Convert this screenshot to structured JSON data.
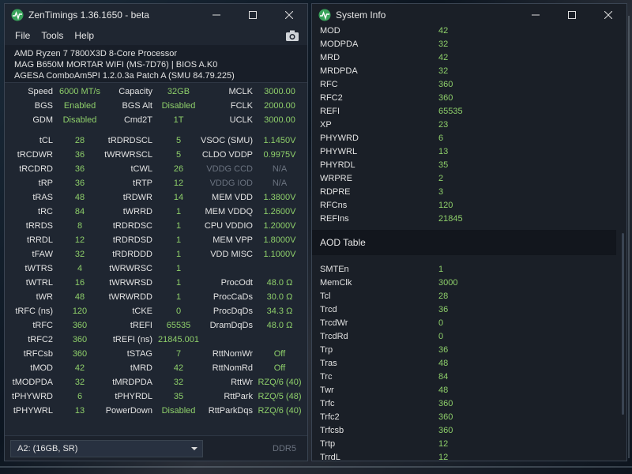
{
  "zentimings": {
    "title": "ZenTimings 1.36.1650 - beta",
    "menu": [
      "File",
      "Tools",
      "Help"
    ],
    "system": {
      "cpu": "AMD Ryzen 7 7800X3D 8-Core Processor",
      "board": "MAG B650M MORTAR WIFI (MS-7D76) | BIOS A.K0",
      "agesa": "AGESA ComboAm5PI 1.2.0.3a Patch A (SMU 84.79.225)"
    },
    "top_rows": [
      [
        "Speed",
        "6000 MT/s",
        "Capacity",
        "32GB",
        "MCLK",
        "3000.00"
      ],
      [
        "BGS",
        "Enabled",
        "BGS Alt",
        "Disabled",
        "FCLK",
        "2000.00"
      ],
      [
        "GDM",
        "Disabled",
        "Cmd2T",
        "1T",
        "UCLK",
        "3000.00"
      ]
    ],
    "rows": [
      [
        "tCL",
        "28",
        "tRDRDSCL",
        "5",
        "VSOC (SMU)",
        "1.1450V"
      ],
      [
        "tRCDWR",
        "36",
        "tWRWRSCL",
        "5",
        "CLDO VDDP",
        "0.9975V"
      ],
      [
        "tRCDRD",
        "36",
        "tCWL",
        "26",
        "VDDG CCD",
        "N/A"
      ],
      [
        "tRP",
        "36",
        "tRTP",
        "12",
        "VDDG IOD",
        "N/A"
      ],
      [
        "tRAS",
        "48",
        "tRDWR",
        "14",
        "MEM VDD",
        "1.3800V"
      ],
      [
        "tRC",
        "84",
        "tWRRD",
        "1",
        "MEM VDDQ",
        "1.2600V"
      ],
      [
        "tRRDS",
        "8",
        "tRDRDSC",
        "1",
        "CPU VDDIO",
        "1.2000V"
      ],
      [
        "tRRDL",
        "12",
        "tRDRDSD",
        "1",
        "MEM VPP",
        "1.8000V"
      ],
      [
        "tFAW",
        "32",
        "tRDRDDD",
        "1",
        "VDD MISC",
        "1.1000V"
      ],
      [
        "tWTRS",
        "4",
        "tWRWRSC",
        "1",
        "",
        ""
      ],
      [
        "tWTRL",
        "16",
        "tWRWRSD",
        "1",
        "ProcOdt",
        "48.0 Ω"
      ],
      [
        "tWR",
        "48",
        "tWRWRDD",
        "1",
        "ProcCaDs",
        "30.0 Ω"
      ],
      [
        "tRFC (ns)",
        "120",
        "tCKE",
        "0",
        "ProcDqDs",
        "34.3 Ω"
      ],
      [
        "tRFC",
        "360",
        "tREFI",
        "65535",
        "DramDqDs",
        "48.0 Ω"
      ],
      [
        "tRFC2",
        "360",
        "tREFI (ns)",
        "21845.001",
        "",
        ""
      ],
      [
        "tRFCsb",
        "360",
        "tSTAG",
        "7",
        "RttNomWr",
        "Off"
      ],
      [
        "tMOD",
        "42",
        "tMRD",
        "42",
        "RttNomRd",
        "Off"
      ],
      [
        "tMODPDA",
        "32",
        "tMRDPDA",
        "32",
        "RttWr",
        "RZQ/6 (40)"
      ],
      [
        "tPHYWRD",
        "6",
        "tPHYRDL",
        "35",
        "RttPark",
        "RZQ/5 (48)"
      ],
      [
        "tPHYWRL",
        "13",
        "PowerDown",
        "Disabled",
        "RttParkDqs",
        "RZQ/6 (40)"
      ]
    ],
    "dropdown_value": "A2: (16GB, SR)",
    "ddr_type": "DDR5"
  },
  "sysinfo": {
    "title": "System Info",
    "rows_top": [
      [
        "MOD",
        "42"
      ],
      [
        "MODPDA",
        "32"
      ],
      [
        "MRD",
        "42"
      ],
      [
        "MRDPDA",
        "32"
      ],
      [
        "RFC",
        "360"
      ],
      [
        "RFC2",
        "360"
      ],
      [
        "REFI",
        "65535"
      ],
      [
        "XP",
        "23"
      ],
      [
        "PHYWRD",
        "6"
      ],
      [
        "PHYWRL",
        "13"
      ],
      [
        "PHYRDL",
        "35"
      ],
      [
        "WRPRE",
        "2"
      ],
      [
        "RDPRE",
        "3"
      ],
      [
        "RFCns",
        "120"
      ],
      [
        "REFIns",
        "21845"
      ]
    ],
    "section_title": "AOD Table",
    "rows_aod": [
      [
        "SMTEn",
        "1"
      ],
      [
        "MemClk",
        "3000"
      ],
      [
        "Tcl",
        "28"
      ],
      [
        "Trcd",
        "36"
      ],
      [
        "TrcdWr",
        "0"
      ],
      [
        "TrcdRd",
        "0"
      ],
      [
        "Trp",
        "36"
      ],
      [
        "Tras",
        "48"
      ],
      [
        "Trc",
        "84"
      ],
      [
        "Twr",
        "48"
      ],
      [
        "Trfc",
        "360"
      ],
      [
        "Trfc2",
        "360"
      ],
      [
        "Trfcsb",
        "360"
      ],
      [
        "Trtp",
        "12"
      ],
      [
        "TrrdL",
        "12"
      ]
    ]
  },
  "colors": {
    "value_green": "#8ecf6a",
    "label": "#e2e2e2",
    "dim": "#6b7380"
  }
}
